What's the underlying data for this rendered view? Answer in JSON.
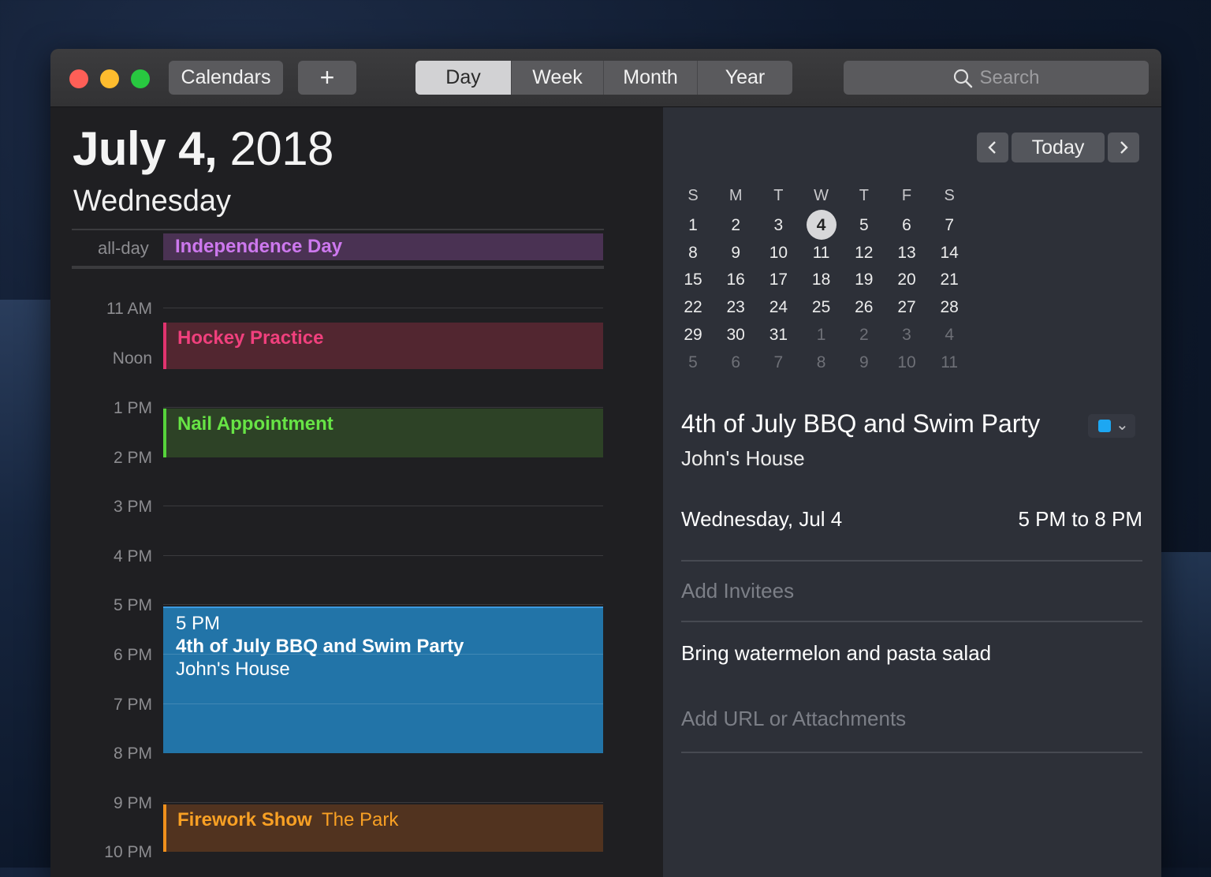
{
  "toolbar": {
    "calendars_label": "Calendars",
    "add_label": "+",
    "views": [
      {
        "label": "Day",
        "active": true
      },
      {
        "label": "Week",
        "active": false
      },
      {
        "label": "Month",
        "active": false
      },
      {
        "label": "Year",
        "active": false
      }
    ],
    "search_placeholder": "Search"
  },
  "day": {
    "month_day": "July 4,",
    "year": "2018",
    "weekday": "Wednesday",
    "allday_label": "all-day",
    "allday_event": "Independence Day",
    "hours": [
      "11 AM",
      "Noon",
      "1 PM",
      "2 PM",
      "3 PM",
      "4 PM",
      "5 PM",
      "6 PM",
      "7 PM",
      "8 PM",
      "9 PM",
      "10 PM"
    ],
    "events": {
      "hockey": {
        "title": "Hockey Practice",
        "color": "#e2336f"
      },
      "nail": {
        "title": "Nail Appointment",
        "color": "#56d33b"
      },
      "bbq": {
        "time": "5 PM",
        "title": "4th of July BBQ and Swim Party",
        "location": "John's House",
        "color": "#2274a8"
      },
      "firework": {
        "title": "Firework Show",
        "location": "The Park",
        "color": "#f0901c"
      }
    }
  },
  "mini_calendar": {
    "prev_icon": "chevron-left-icon",
    "today_label": "Today",
    "next_icon": "chevron-right-icon",
    "weekday_headers": [
      "S",
      "M",
      "T",
      "W",
      "T",
      "F",
      "S"
    ],
    "weeks": [
      [
        "1",
        "2",
        "3",
        "4",
        "5",
        "6",
        "7"
      ],
      [
        "8",
        "9",
        "10",
        "11",
        "12",
        "13",
        "14"
      ],
      [
        "15",
        "16",
        "17",
        "18",
        "19",
        "20",
        "21"
      ],
      [
        "22",
        "23",
        "24",
        "25",
        "26",
        "27",
        "28"
      ],
      [
        "29",
        "30",
        "31",
        "1",
        "2",
        "3",
        "4"
      ],
      [
        "5",
        "6",
        "7",
        "8",
        "9",
        "10",
        "11"
      ]
    ],
    "selected_day": "4"
  },
  "detail": {
    "title": "4th of July BBQ and Swim Party",
    "location": "John's House",
    "calendar_color": "#1da7f2",
    "date": "Wednesday, Jul 4",
    "time_range": "5 PM to 8 PM",
    "add_invitees": "Add Invitees",
    "notes": "Bring watermelon and pasta salad",
    "add_url": "Add URL or Attachments"
  }
}
